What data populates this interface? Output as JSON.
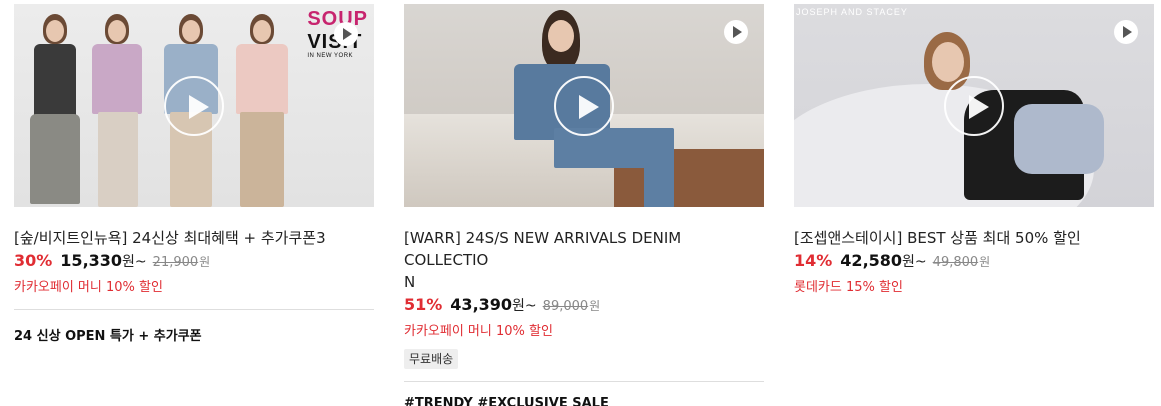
{
  "products": [
    {
      "brand_logo_lines": [
        "SOUP",
        "VISIT",
        "IN NEW YORK"
      ],
      "title": "[숲/비지트인뉴욕] 24신상 최대혜택 + 추가쿠폰3",
      "discount": "30%",
      "price": "15,330",
      "price_unit": "원~",
      "original_price": "21,900",
      "original_unit": "원",
      "benefit": "카카오페이 머니 10% 할인",
      "tag": "",
      "promo": "24 신상 OPEN 특가 + 추가쿠폰"
    },
    {
      "title_line1": "[WARR] 24S/S NEW ARRIVALS DENIM COLLECTIO",
      "title_line2": "N",
      "discount": "51%",
      "price": "43,390",
      "price_unit": "원~",
      "original_price": "89,000",
      "original_unit": "원",
      "benefit": "카카오페이 머니 10% 할인",
      "tag": "무료배송",
      "promo": "#TRENDY #EXCLUSIVE SALE"
    },
    {
      "brand_logo": "JOSEPH AND STACEY",
      "title": "[조셉앤스테이시] BEST 상품 최대 50% 할인",
      "discount": "14%",
      "price": "42,580",
      "price_unit": "원~",
      "original_price": "49,800",
      "original_unit": "원",
      "benefit": "롯데카드 15% 할인",
      "tag": ""
    }
  ],
  "icons": {
    "play_large": "play-circle-icon",
    "play_small": "play-badge-icon"
  },
  "colors": {
    "discount": "#e02d33",
    "benefit": "#e02d33",
    "soup_brand": "#c7246e"
  }
}
